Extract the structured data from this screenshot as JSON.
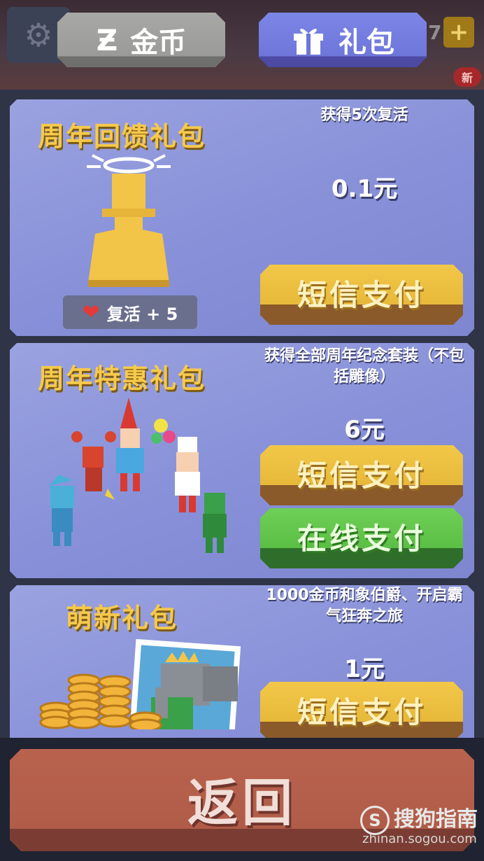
{
  "header": {
    "coins_tab_label": "金币",
    "coins_tab_icon": "currency-z-icon",
    "gift_tab_label": "礼包",
    "gift_tab_icon": "gift-box-icon",
    "count_text": "7",
    "plus_label": "+",
    "new_badge": "新"
  },
  "packs": [
    {
      "title": "周年回馈礼包",
      "description": "获得5次复活",
      "price": "0.1元",
      "revive_label": "复活 + 5",
      "buttons": [
        "短信支付"
      ]
    },
    {
      "title": "周年特惠礼包",
      "description": "获得全部周年纪念套装（不包括雕像）",
      "price": "6元",
      "buttons": [
        "短信支付",
        "在线支付"
      ]
    },
    {
      "title": "萌新礼包",
      "description": "1000金币和象伯爵、开启霸气狂奔之旅",
      "price": "1元",
      "buttons": [
        "短信支付"
      ]
    }
  ],
  "footer": {
    "back_label": "返回"
  },
  "watermark": {
    "text": "搜狗指南",
    "url_text": "zhinan.sogou.com"
  },
  "colors": {
    "gold_title": "#f6c94b",
    "sms_button": "#f2c748",
    "online_button": "#6fcf56",
    "back_button": "#b9634f",
    "gift_tab": "#7d86e6",
    "coins_tab": "#a8a9a6"
  }
}
